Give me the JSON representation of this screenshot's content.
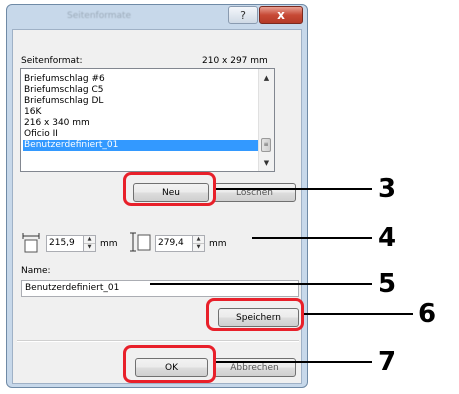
{
  "dialog": {
    "title": "Seitenformate",
    "help_glyph": "?",
    "close_glyph": "x"
  },
  "paper": {
    "label": "Seitenformat:",
    "dimensions": "210 x 297 mm",
    "items": [
      {
        "label": "Briefumschlag #6",
        "selected": false
      },
      {
        "label": "Briefumschlag C5",
        "selected": false
      },
      {
        "label": "Briefumschlag DL",
        "selected": false
      },
      {
        "label": "16K",
        "selected": false
      },
      {
        "label": "216 x 340 mm",
        "selected": false
      },
      {
        "label": "Oficio II",
        "selected": false
      },
      {
        "label": "Benutzerdefiniert_01",
        "selected": true
      }
    ]
  },
  "buttons": {
    "new": "Neu",
    "delete": "Löschen",
    "save": "Speichern",
    "ok": "OK",
    "cancel": "Abbrechen"
  },
  "size": {
    "width_value": "215,9",
    "width_unit": "mm",
    "height_value": "279,4",
    "height_unit": "mm"
  },
  "name": {
    "label": "Name:",
    "value": "Benutzerdefiniert_01"
  },
  "callouts": {
    "n3": "3",
    "n4": "4",
    "n5": "5",
    "n6": "6",
    "n7": "7"
  }
}
